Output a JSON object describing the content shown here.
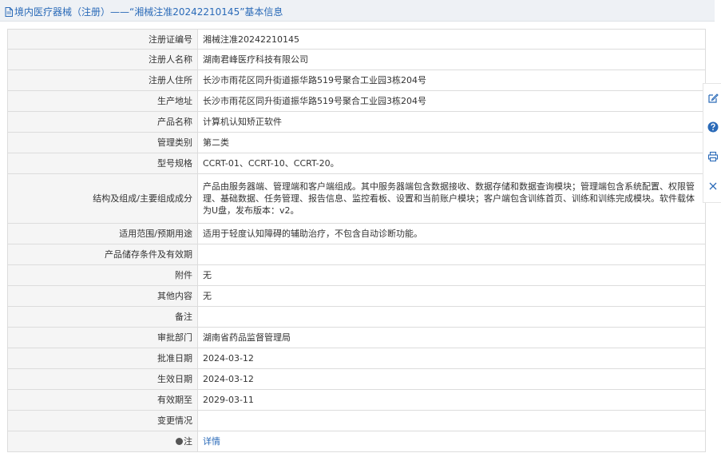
{
  "header": {
    "title": "境内医疗器械（注册）——“湘械注准20242210145”基本信息"
  },
  "rows": [
    {
      "label": "注册证编号",
      "value": "湘械注准20242210145"
    },
    {
      "label": "注册人名称",
      "value": "湖南君峰医疗科技有限公司"
    },
    {
      "label": "注册人住所",
      "value": "长沙市雨花区同升街道振华路519号聚合工业园3栋204号"
    },
    {
      "label": "生产地址",
      "value": "长沙市雨花区同升街道振华路519号聚合工业园3栋204号"
    },
    {
      "label": "产品名称",
      "value": "计算机认知矫正软件"
    },
    {
      "label": "管理类别",
      "value": "第二类"
    },
    {
      "label": "型号规格",
      "value": "CCRT-01、CCRT-10、CCRT-20。"
    },
    {
      "label": "结构及组成/主要组成成分",
      "value": "产品由服务器端、管理端和客户端组成。其中服务器端包含数据接收、数据存储和数据查询模块；管理端包含系统配置、权限管理、基础数据、任务管理、报告信息、监控看板、设置和当前账户模块；客户端包含训练首页、训练和训练完成模块。软件载体为U盘，发布版本：v2。"
    },
    {
      "label": "适用范围/预期用途",
      "value": "适用于轻度认知障碍的辅助治疗，不包含自动诊断功能。"
    },
    {
      "label": "产品储存条件及有效期",
      "value": ""
    },
    {
      "label": "附件",
      "value": "无"
    },
    {
      "label": "其他内容",
      "value": "无"
    },
    {
      "label": "备注",
      "value": ""
    },
    {
      "label": "审批部门",
      "value": "湖南省药品监督管理局"
    },
    {
      "label": "批准日期",
      "value": "2024-03-12"
    },
    {
      "label": "生效日期",
      "value": "2024-03-12"
    },
    {
      "label": "有效期至",
      "value": "2029-03-11"
    },
    {
      "label": "变更情况",
      "value": ""
    }
  ],
  "note": {
    "label": "注",
    "link": "详情"
  },
  "toolbar": {
    "icons": [
      "edit-icon",
      "help-icon",
      "print-icon",
      "close-icon"
    ],
    "help_color": "#2a6ab8"
  }
}
